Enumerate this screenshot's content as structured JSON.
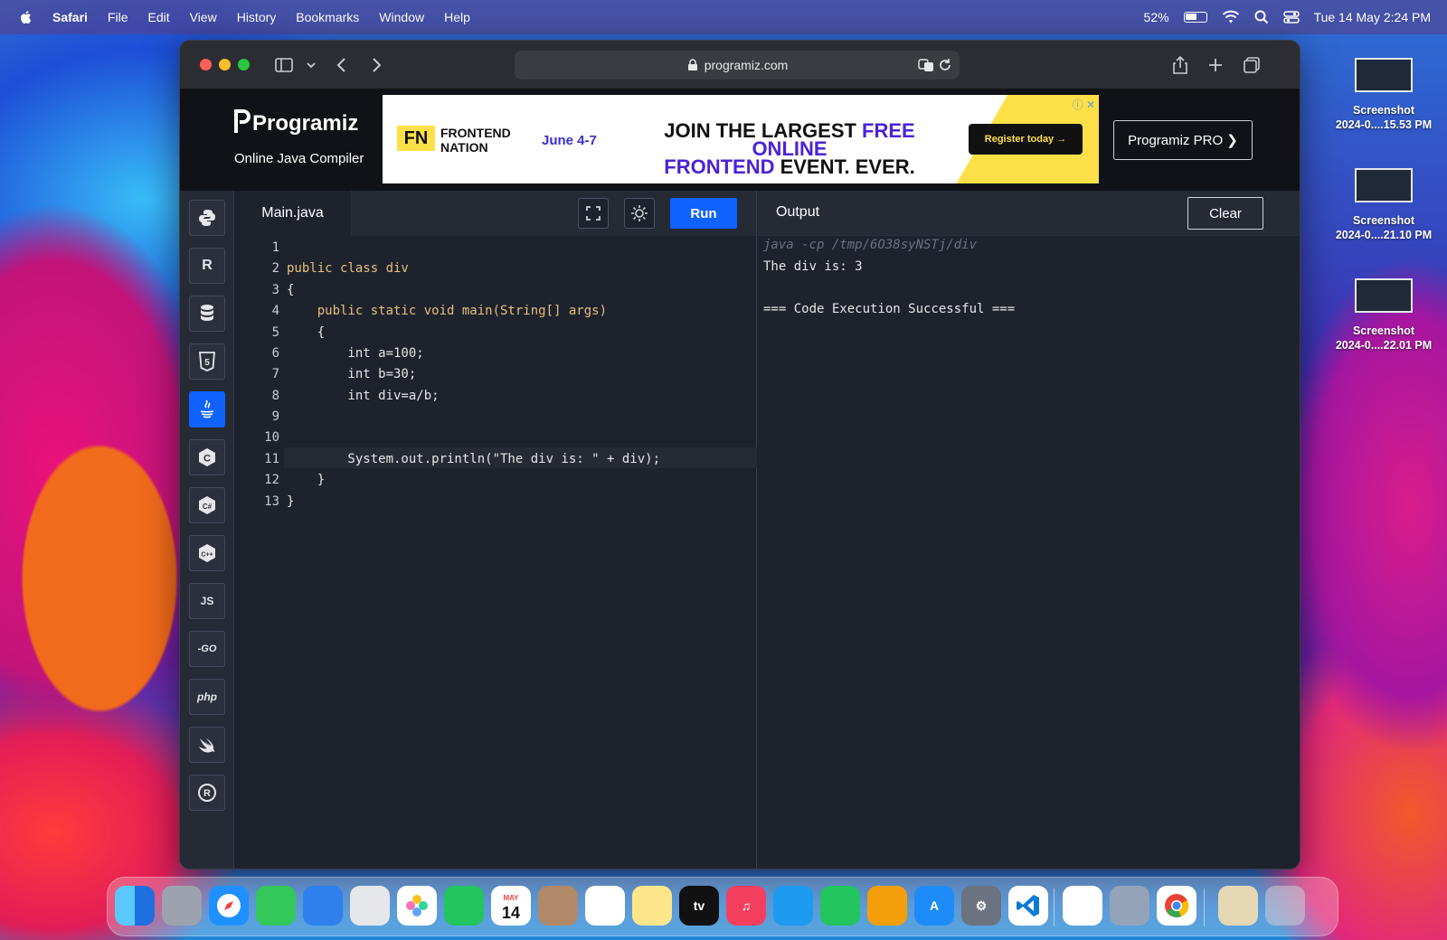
{
  "menubar": {
    "app_name": "Safari",
    "items": [
      "File",
      "Edit",
      "View",
      "History",
      "Bookmarks",
      "Window",
      "Help"
    ],
    "battery": "52%",
    "clock": "Tue 14 May  2:24 PM"
  },
  "browser": {
    "url": "programiz.com"
  },
  "site": {
    "logo": "Programiz",
    "subtitle": "Online Java Compiler",
    "pro_button": "Programiz PRO ❯",
    "ad": {
      "brand_mark": "FN",
      "brand_line1": "FRONTEND",
      "brand_line2": "NATION",
      "date": "June 4-7",
      "headline_part1": "JOIN THE LARGEST ",
      "headline_highlight1": "FREE ONLINE",
      "headline_highlight2": "FRONTEND",
      "headline_part2": " EVENT. EVER.",
      "cta": "Register today →"
    }
  },
  "sidebar": {
    "languages": [
      {
        "name": "python",
        "label": ""
      },
      {
        "name": "r",
        "label": "R"
      },
      {
        "name": "sql",
        "label": ""
      },
      {
        "name": "html",
        "label": "5"
      },
      {
        "name": "java",
        "label": ""
      },
      {
        "name": "c",
        "label": "C"
      },
      {
        "name": "csharp",
        "label": "C#"
      },
      {
        "name": "cpp",
        "label": "C++"
      },
      {
        "name": "js",
        "label": "JS"
      },
      {
        "name": "go",
        "label": "-GO"
      },
      {
        "name": "php",
        "label": "php"
      },
      {
        "name": "swift",
        "label": ""
      },
      {
        "name": "rust",
        "label": "R"
      }
    ],
    "active": "java"
  },
  "editor": {
    "file_tab": "Main.java",
    "run_label": "Run",
    "lines": [
      {
        "n": "1",
        "code": ""
      },
      {
        "n": "2",
        "code": "public class div"
      },
      {
        "n": "3",
        "code": "{"
      },
      {
        "n": "4",
        "code": "    public static void main(String[] args)"
      },
      {
        "n": "5",
        "code": "    {"
      },
      {
        "n": "6",
        "code": "        int a=100;"
      },
      {
        "n": "7",
        "code": "        int b=30;"
      },
      {
        "n": "8",
        "code": "        int div=a/b;"
      },
      {
        "n": "9",
        "code": ""
      },
      {
        "n": "10",
        "code": ""
      },
      {
        "n": "11",
        "code": "        System.out.println(\"The div is: \" + div);"
      },
      {
        "n": "12",
        "code": "    }"
      },
      {
        "n": "13",
        "code": "}"
      }
    ]
  },
  "output": {
    "title": "Output",
    "clear_label": "Clear",
    "command": "java -cp /tmp/6O38syNSTj/div",
    "result": "The div is: 3",
    "status": "=== Code Execution Successful ==="
  },
  "desktop": {
    "screenshots": [
      {
        "title": "Screenshot",
        "date": "2024-0....15.53 PM"
      },
      {
        "title": "Screenshot",
        "date": "2024-0....21.10 PM"
      },
      {
        "title": "Screenshot",
        "date": "2024-0....22.01 PM"
      }
    ]
  },
  "dock": {
    "calendar_month": "MAY",
    "calendar_day": "14",
    "tv_label": "tv"
  }
}
